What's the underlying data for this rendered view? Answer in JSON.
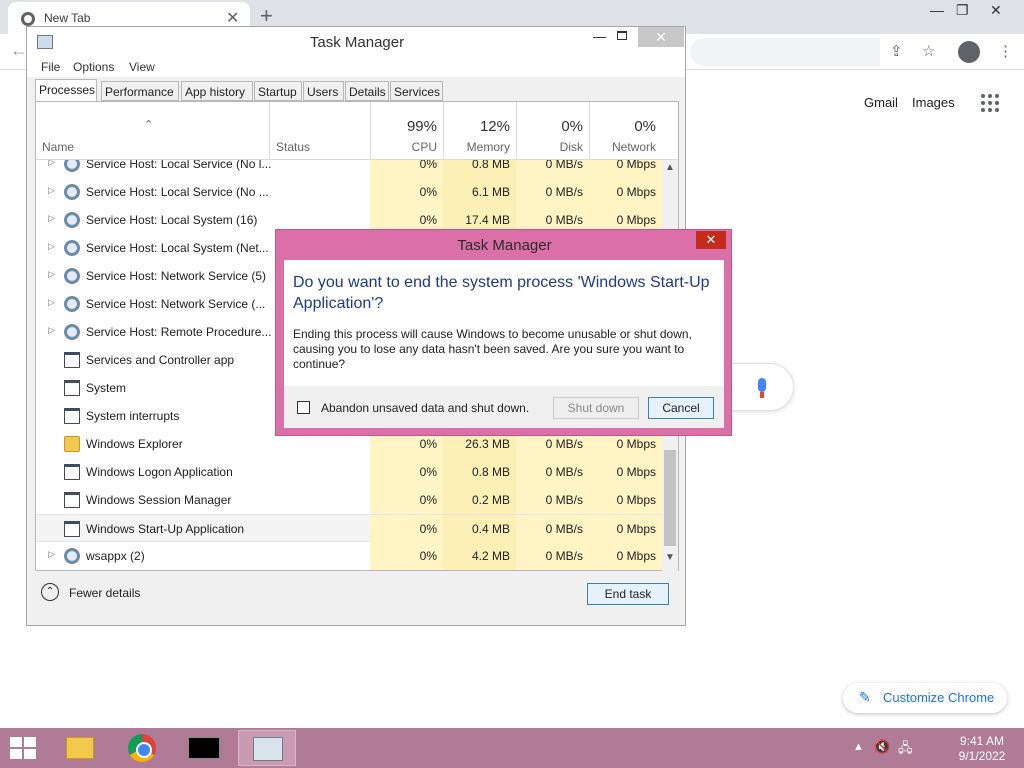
{
  "browser": {
    "tab_title": "New Tab",
    "gmail": "Gmail",
    "images": "Images",
    "customize": "Customize Chrome"
  },
  "taskmanager": {
    "title": "Task Manager",
    "menu": [
      "File",
      "Options",
      "View"
    ],
    "tabs": [
      "Processes",
      "Performance",
      "App history",
      "Startup",
      "Users",
      "Details",
      "Services"
    ],
    "columns": {
      "name": "Name",
      "status": "Status",
      "cpu": {
        "pct": "99%",
        "label": "CPU"
      },
      "memory": {
        "pct": "12%",
        "label": "Memory"
      },
      "disk": {
        "pct": "0%",
        "label": "Disk"
      },
      "network": {
        "pct": "0%",
        "label": "Network"
      }
    },
    "rows": [
      {
        "name": "Service Host: Local Service (No l...",
        "cpu": "0%",
        "mem": "0.8 MB",
        "disk": "0 MB/s",
        "net": "0 Mbps"
      },
      {
        "name": "Service Host: Local Service (No ...",
        "cpu": "0%",
        "mem": "6.1 MB",
        "disk": "0 MB/s",
        "net": "0 Mbps"
      },
      {
        "name": "Service Host: Local System (16)",
        "cpu": "0%",
        "mem": "17.4 MB",
        "disk": "0 MB/s",
        "net": "0 Mbps"
      },
      {
        "name": "Service Host: Local System (Net...",
        "cpu": "",
        "mem": "",
        "disk": "",
        "net": ""
      },
      {
        "name": "Service Host: Network Service (5)",
        "cpu": "",
        "mem": "",
        "disk": "",
        "net": ""
      },
      {
        "name": "Service Host: Network Service (...",
        "cpu": "",
        "mem": "",
        "disk": "",
        "net": ""
      },
      {
        "name": "Service Host: Remote Procedure...",
        "cpu": "",
        "mem": "",
        "disk": "",
        "net": ""
      },
      {
        "name": "Services and Controller app",
        "cpu": "",
        "mem": "",
        "disk": "",
        "net": ""
      },
      {
        "name": "System",
        "cpu": "",
        "mem": "",
        "disk": "",
        "net": ""
      },
      {
        "name": "System interrupts",
        "cpu": "",
        "mem": "",
        "disk": "",
        "net": ""
      },
      {
        "name": "Windows Explorer",
        "cpu": "0%",
        "mem": "26.3 MB",
        "disk": "0 MB/s",
        "net": "0 Mbps"
      },
      {
        "name": "Windows Logon Application",
        "cpu": "0%",
        "mem": "0.8 MB",
        "disk": "0 MB/s",
        "net": "0 Mbps"
      },
      {
        "name": "Windows Session Manager",
        "cpu": "0%",
        "mem": "0.2 MB",
        "disk": "0 MB/s",
        "net": "0 Mbps"
      },
      {
        "name": "Windows Start-Up Application",
        "cpu": "0%",
        "mem": "0.4 MB",
        "disk": "0 MB/s",
        "net": "0 Mbps"
      },
      {
        "name": "wsappx (2)",
        "cpu": "0%",
        "mem": "4.2 MB",
        "disk": "0 MB/s",
        "net": "0 Mbps"
      }
    ],
    "fewer_details": "Fewer details",
    "end_task": "End task"
  },
  "dialog": {
    "title": "Task Manager",
    "main": "Do you want to end the system process 'Windows Start-Up Application'?",
    "body": "Ending this process will cause Windows to become unusable or shut down, causing you to lose any data hasn't been saved. Are you sure you want to continue?",
    "checkbox_label": "Abandon unsaved data and shut down.",
    "shutdown": "Shut down",
    "cancel": "Cancel"
  },
  "taskbar": {
    "time": "9:41 AM",
    "date": "9/1/2022"
  }
}
